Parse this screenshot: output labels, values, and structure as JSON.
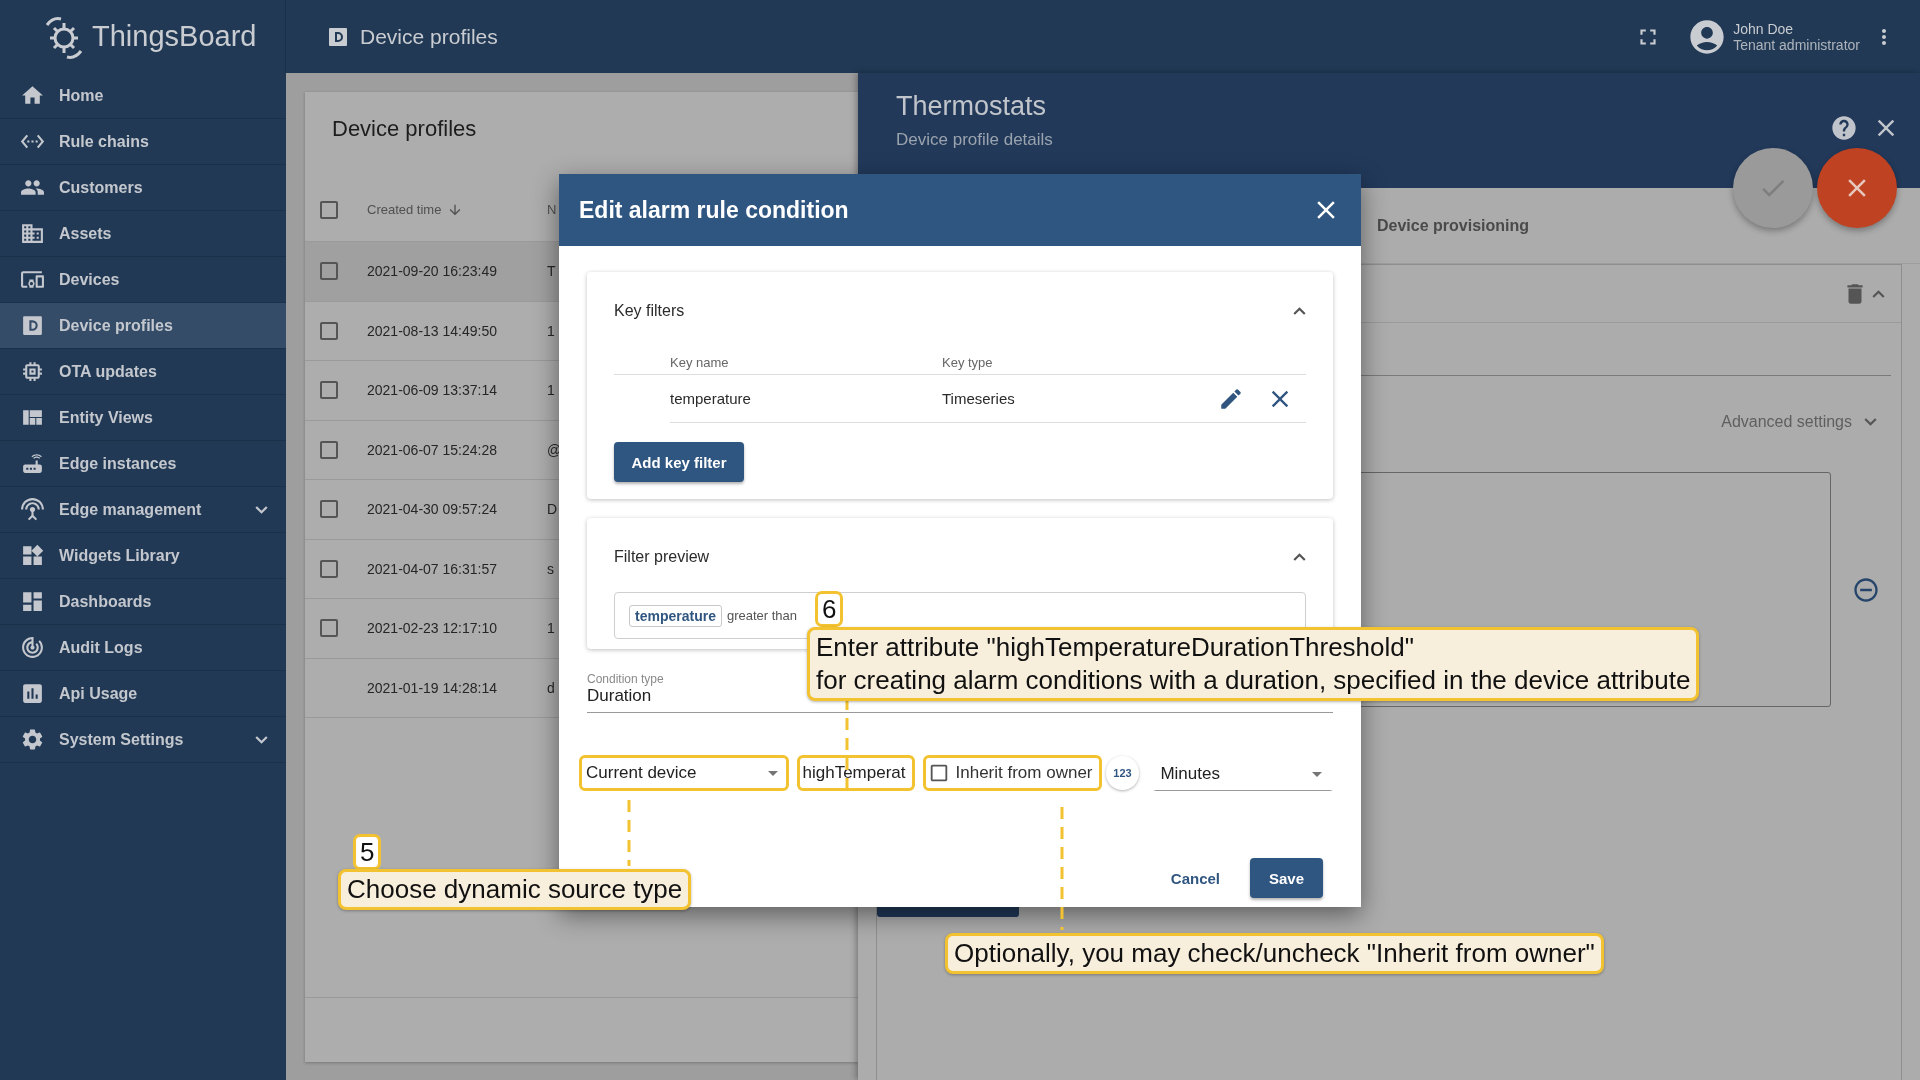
{
  "app": {
    "logo_text": "ThingsBoard"
  },
  "sidebar": {
    "items": [
      {
        "label": "Home",
        "kind": "link",
        "selected": false
      },
      {
        "label": "Rule chains",
        "kind": "link",
        "selected": false
      },
      {
        "label": "Customers",
        "kind": "link",
        "selected": false
      },
      {
        "label": "Assets",
        "kind": "link",
        "selected": false
      },
      {
        "label": "Devices",
        "kind": "link",
        "selected": false
      },
      {
        "label": "Device profiles",
        "kind": "link",
        "selected": true
      },
      {
        "label": "OTA updates",
        "kind": "link",
        "selected": false
      },
      {
        "label": "Entity Views",
        "kind": "link",
        "selected": false
      },
      {
        "label": "Edge instances",
        "kind": "link",
        "selected": false
      },
      {
        "label": "Edge management",
        "kind": "group",
        "expanded": false,
        "selected": false
      },
      {
        "label": "Widgets Library",
        "kind": "link",
        "selected": false
      },
      {
        "label": "Dashboards",
        "kind": "link",
        "selected": false
      },
      {
        "label": "Audit Logs",
        "kind": "link",
        "selected": false
      },
      {
        "label": "Api Usage",
        "kind": "link",
        "selected": false
      },
      {
        "label": "System Settings",
        "kind": "group",
        "expanded": false,
        "selected": false
      }
    ]
  },
  "header": {
    "title": "Device profiles",
    "user_name": "John Doe",
    "user_role": "Tenant administrator"
  },
  "profiles_table": {
    "title": "Device profiles",
    "all_checked": false,
    "columns": [
      {
        "label": "Created time",
        "sort_descending": true
      },
      {
        "label": "N"
      }
    ],
    "rows": [
      {
        "created": "2021-09-20 16:23:49",
        "column_2": "T",
        "kind": "selectable",
        "checked": false,
        "selected": true
      },
      {
        "created": "2021-08-13 14:49:50",
        "column_2": "1",
        "kind": "selectable",
        "checked": false,
        "selected": false
      },
      {
        "created": "2021-06-09 13:37:14",
        "column_2": "1",
        "kind": "selectable",
        "checked": false,
        "selected": false
      },
      {
        "created": "2021-06-07 15:24:28",
        "column_2": "@",
        "kind": "selectable",
        "checked": false,
        "selected": false
      },
      {
        "created": "2021-04-30 09:57:24",
        "column_2": "D",
        "kind": "selectable",
        "checked": false,
        "selected": false
      },
      {
        "created": "2021-04-07 16:31:57",
        "column_2": "s",
        "kind": "selectable",
        "checked": false,
        "selected": false
      },
      {
        "created": "2021-02-23 12:17:10",
        "column_2": "1",
        "kind": "selectable",
        "checked": false,
        "selected": false
      },
      {
        "created": "2021-01-19 14:28:14",
        "column_2": "d",
        "kind": "plain",
        "selected": false
      }
    ]
  },
  "details": {
    "title": "Thermostats",
    "subtitle": "Device profile details",
    "tab": "Device provisioning",
    "advanced_label": "Advanced settings",
    "advanced_expanded": false,
    "rule_expanded": true
  },
  "dialog": {
    "title": "Edit alarm rule condition",
    "key_filters": {
      "title": "Key filters",
      "expanded": true,
      "columns": [
        "Key name",
        "Key type"
      ],
      "rows": [
        {
          "key_name": "temperature",
          "key_type": "Timeseries"
        }
      ],
      "add_button": "Add key filter"
    },
    "filter_preview": {
      "title": "Filter preview",
      "expanded": true,
      "key": "temperature",
      "operation": "greater than"
    },
    "condition_type": {
      "label": "Condition type",
      "value": "Duration"
    },
    "duration_row": [
      {
        "kind": "select",
        "value": "Current device",
        "highlighted": true
      },
      {
        "kind": "input",
        "value": "highTemperat",
        "highlighted": true
      },
      {
        "kind": "checkbox",
        "label": "Inherit from owner",
        "checked": false,
        "highlighted": true
      },
      {
        "kind": "badge",
        "label": "123"
      },
      {
        "kind": "select",
        "value": "Minutes",
        "highlighted": false
      }
    ],
    "actions": [
      {
        "label": "Cancel",
        "kind": "text"
      },
      {
        "label": "Save",
        "kind": "primary"
      }
    ]
  },
  "callouts": [
    {
      "number": "6",
      "lines": [
        "Enter attribute \"highTemperatureDurationThreshold\"",
        "for creating alarm conditions with a duration, specified in the device attribute"
      ]
    },
    {
      "number": "5",
      "lines": [
        "Choose dynamic source type"
      ]
    },
    {
      "lines": [
        "Optionally, you may check/uncheck \"Inherit from owner\""
      ]
    }
  ]
}
